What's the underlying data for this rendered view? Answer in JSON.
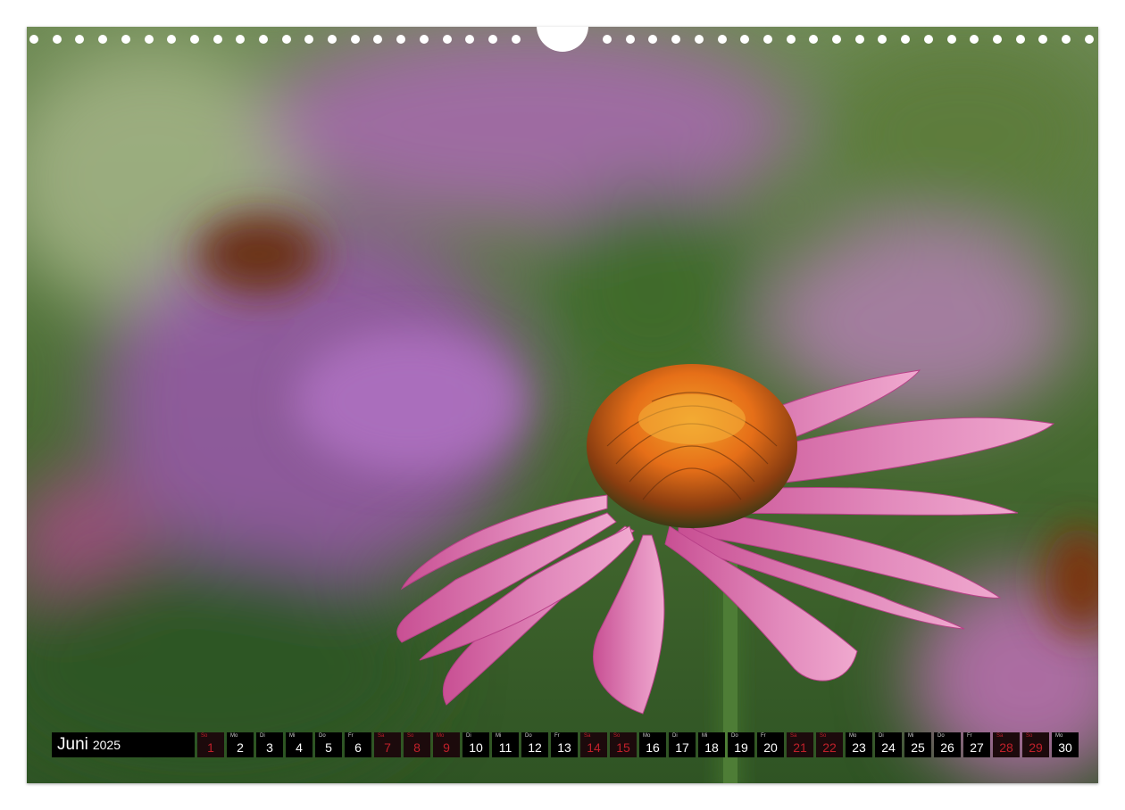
{
  "calendar": {
    "month": "Juni",
    "year": "2025",
    "days": [
      {
        "num": "1",
        "dow": "So",
        "red": true
      },
      {
        "num": "2",
        "dow": "Mo",
        "red": false
      },
      {
        "num": "3",
        "dow": "Di",
        "red": false
      },
      {
        "num": "4",
        "dow": "Mi",
        "red": false
      },
      {
        "num": "5",
        "dow": "Do",
        "red": false
      },
      {
        "num": "6",
        "dow": "Fr",
        "red": false
      },
      {
        "num": "7",
        "dow": "Sa",
        "red": true
      },
      {
        "num": "8",
        "dow": "So",
        "red": true
      },
      {
        "num": "9",
        "dow": "Mo",
        "red": true
      },
      {
        "num": "10",
        "dow": "Di",
        "red": false
      },
      {
        "num": "11",
        "dow": "Mi",
        "red": false
      },
      {
        "num": "12",
        "dow": "Do",
        "red": false
      },
      {
        "num": "13",
        "dow": "Fr",
        "red": false
      },
      {
        "num": "14",
        "dow": "Sa",
        "red": true
      },
      {
        "num": "15",
        "dow": "So",
        "red": true
      },
      {
        "num": "16",
        "dow": "Mo",
        "red": false
      },
      {
        "num": "17",
        "dow": "Di",
        "red": false
      },
      {
        "num": "18",
        "dow": "Mi",
        "red": false
      },
      {
        "num": "19",
        "dow": "Do",
        "red": false
      },
      {
        "num": "20",
        "dow": "Fr",
        "red": false
      },
      {
        "num": "21",
        "dow": "Sa",
        "red": true
      },
      {
        "num": "22",
        "dow": "So",
        "red": true
      },
      {
        "num": "23",
        "dow": "Mo",
        "red": false
      },
      {
        "num": "24",
        "dow": "Di",
        "red": false
      },
      {
        "num": "25",
        "dow": "Mi",
        "red": false
      },
      {
        "num": "26",
        "dow": "Do",
        "red": false
      },
      {
        "num": "27",
        "dow": "Fr",
        "red": false
      },
      {
        "num": "28",
        "dow": "Sa",
        "red": true
      },
      {
        "num": "29",
        "dow": "So",
        "red": true
      },
      {
        "num": "30",
        "dow": "Mo",
        "red": false
      }
    ]
  },
  "colors": {
    "weekend_red": "#c0202a",
    "strip_black": "#000000",
    "petal_pink": "#d9609f",
    "cone_orange": "#e8761c",
    "background_green": "#4d6b34"
  },
  "icons": {
    "binding": "spiral-binding-holes",
    "hanger": "hanger-notch"
  }
}
